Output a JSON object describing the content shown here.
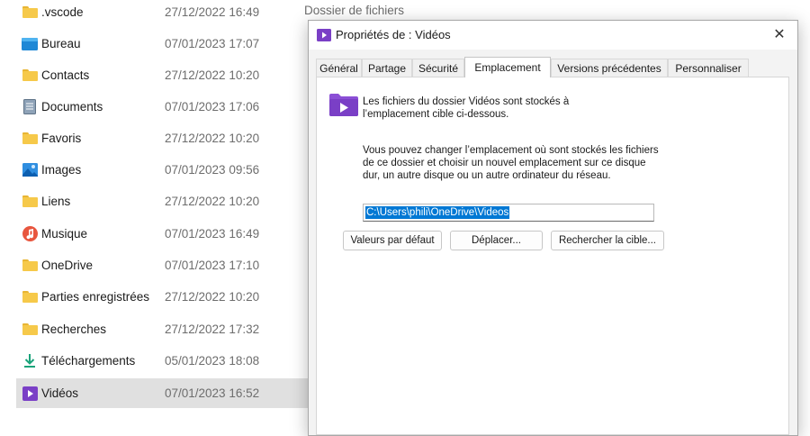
{
  "explorer": {
    "type_header": "Dossier de fichiers",
    "items": [
      {
        "name": ".vscode",
        "date": "27/12/2022 16:49",
        "icon": "folder-icon"
      },
      {
        "name": "Bureau",
        "date": "07/01/2023 17:07",
        "icon": "desktop-icon"
      },
      {
        "name": "Contacts",
        "date": "27/12/2022 10:20",
        "icon": "folder-icon"
      },
      {
        "name": "Documents",
        "date": "07/01/2023 17:06",
        "icon": "documents-icon"
      },
      {
        "name": "Favoris",
        "date": "27/12/2022 10:20",
        "icon": "folder-icon"
      },
      {
        "name": "Images",
        "date": "07/01/2023 09:56",
        "icon": "images-icon"
      },
      {
        "name": "Liens",
        "date": "27/12/2022 10:20",
        "icon": "folder-icon"
      },
      {
        "name": "Musique",
        "date": "07/01/2023 16:49",
        "icon": "music-icon"
      },
      {
        "name": "OneDrive",
        "date": "07/01/2023 17:10",
        "icon": "folder-icon"
      },
      {
        "name": "Parties enregistrées",
        "date": "27/12/2022 10:20",
        "icon": "folder-icon"
      },
      {
        "name": "Recherches",
        "date": "27/12/2022 17:32",
        "icon": "folder-icon"
      },
      {
        "name": "Téléchargements",
        "date": "05/01/2023 18:08",
        "icon": "download-icon"
      },
      {
        "name": "Vidéos",
        "date": "07/01/2023 16:52",
        "icon": "videos-icon",
        "selected": true
      }
    ]
  },
  "dialog": {
    "title": "Propriétés de : Vidéos",
    "close_glyph": "✕",
    "tabs": [
      "Général",
      "Partage",
      "Sécurité",
      "Emplacement",
      "Versions précédentes",
      "Personnaliser"
    ],
    "active_tab": "Emplacement",
    "description": "Les fichiers du dossier Vidéos sont stockés à l’emplacement cible ci-dessous.",
    "instructions": "Vous pouvez changer l’emplacement où sont stockés les fichiers de ce dossier et choisir un nouvel emplacement sur ce disque dur, un autre disque ou un autre ordinateur du réseau.",
    "path_value": "C:\\Users\\phili\\OneDrive\\Videos",
    "buttons": {
      "default": "Valeurs par défaut",
      "move": "Déplacer...",
      "find_target": "Rechercher la cible..."
    }
  },
  "colors": {
    "selection": "#0078d4",
    "folder": "#f6c94a",
    "videos": "#7a3fc6",
    "selected_row": "#e0e0e0"
  }
}
